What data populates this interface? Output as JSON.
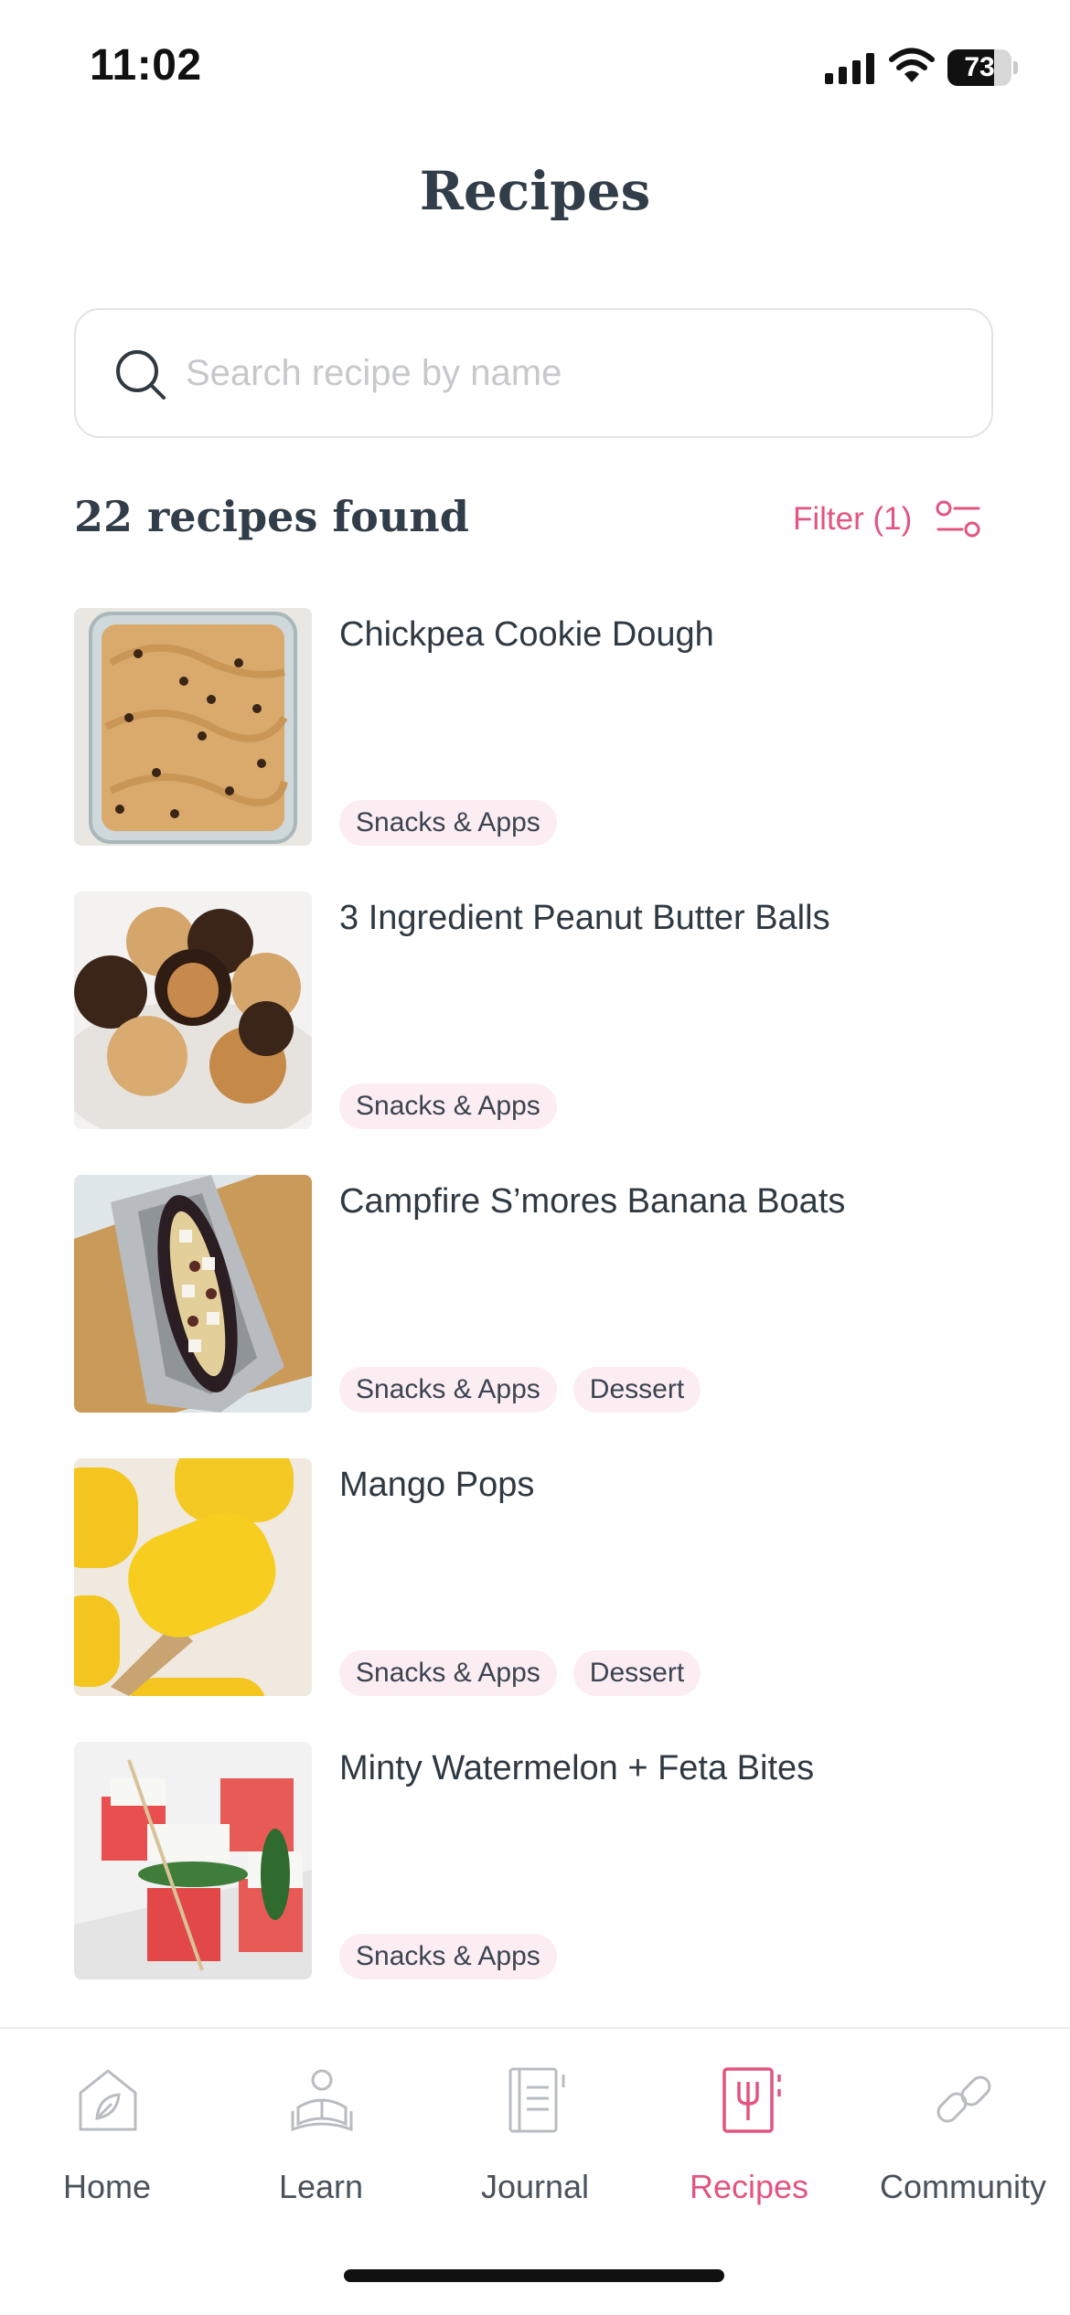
{
  "status_bar": {
    "time": "11:02",
    "battery": "73",
    "battery_level": 0.73
  },
  "header": {
    "title": "Recipes"
  },
  "search": {
    "placeholder": "Search recipe by name",
    "value": ""
  },
  "results": {
    "count_label": "22 recipes found",
    "filter_label": "Filter (1)"
  },
  "recipes": [
    {
      "title": "Chickpea Cookie Dough",
      "tags": [
        "Snacks & Apps"
      ]
    },
    {
      "title": "3 Ingredient Peanut Butter Balls",
      "tags": [
        "Snacks & Apps"
      ]
    },
    {
      "title": "Campfire S’mores Banana Boats",
      "tags": [
        "Snacks & Apps",
        "Dessert"
      ]
    },
    {
      "title": "Mango Pops",
      "tags": [
        "Snacks & Apps",
        "Dessert"
      ]
    },
    {
      "title": "Minty Watermelon + Feta Bites",
      "tags": [
        "Snacks & Apps"
      ]
    }
  ],
  "tab_bar": {
    "tabs": [
      {
        "label": "Home",
        "icon": "home-leaf-icon"
      },
      {
        "label": "Learn",
        "icon": "learn-reader-icon"
      },
      {
        "label": "Journal",
        "icon": "journal-icon"
      },
      {
        "label": "Recipes",
        "icon": "recipes-book-fork-icon",
        "active": true
      },
      {
        "label": "Community",
        "icon": "link-icon"
      }
    ]
  },
  "colors": {
    "accent": "#e2557f",
    "text": "#2f3942",
    "tag_bg": "#fcedf2",
    "muted": "#c7c8cc"
  }
}
